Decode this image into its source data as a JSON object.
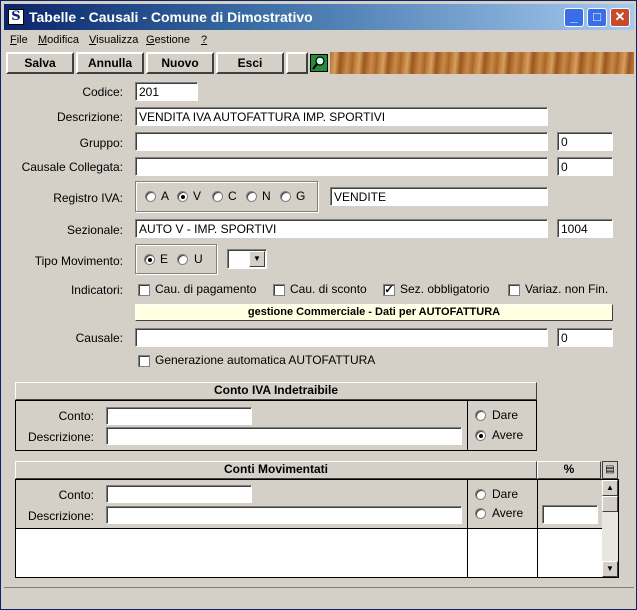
{
  "window": {
    "title": "Tabelle - Causali - Comune di Dimostrativo"
  },
  "menu": [
    "File",
    "Modifica",
    "Visualizza",
    "Gestione",
    "?"
  ],
  "toolbar": {
    "salva": "Salva",
    "annulla": "Annulla",
    "nuovo": "Nuovo",
    "esci": "Esci"
  },
  "form": {
    "codice": {
      "label": "Codice:",
      "value": "201"
    },
    "descrizione": {
      "label": "Descrizione:",
      "value": "VENDITA IVA AUTOFATTURA IMP. SPORTIVI"
    },
    "gruppo": {
      "label": "Gruppo:",
      "value": "",
      "code": "0"
    },
    "causale_collegata": {
      "label": "Causale Collegata:",
      "value": "",
      "code": "0"
    },
    "registro_iva": {
      "label": "Registro IVA:",
      "options": [
        "A",
        "V",
        "C",
        "N",
        "G"
      ],
      "selected": "V",
      "value": "VENDITE"
    },
    "sezionale": {
      "label": "Sezionale:",
      "value": "AUTO V - IMP. SPORTIVI",
      "code": "1004"
    },
    "tipo_movimento": {
      "label": "Tipo Movimento:",
      "options": [
        "E",
        "U"
      ],
      "selected": "E",
      "combo_value": ""
    },
    "indicatori": {
      "label": "Indicatori:",
      "items": [
        {
          "label": "Cau. di pagamento",
          "checked": false
        },
        {
          "label": "Cau. di sconto",
          "checked": false
        },
        {
          "label": "Sez. obbligatorio",
          "checked": true
        },
        {
          "label": "Variaz. non Fin.",
          "checked": false
        }
      ]
    },
    "gestione_bar": "gestione Commerciale - Dati per AUTOFATTURA",
    "causale": {
      "label": "Causale:",
      "value": "",
      "code": "0"
    },
    "generazione": {
      "label": "Generazione automatica AUTOFATTURA",
      "checked": false
    }
  },
  "conto_iva": {
    "header": "Conto IVA Indetraibile",
    "conto_label": "Conto:",
    "descrizione_label": "Descrizione:",
    "conto_value": "",
    "descrizione_value": "",
    "dare": "Dare",
    "avere": "Avere",
    "selected": "Avere"
  },
  "conti_movimentati": {
    "header": "Conti Movimentati",
    "percent_header": "%",
    "conto_label": "Conto:",
    "descrizione_label": "Descrizione:",
    "conto_value": "",
    "descrizione_value": "",
    "dare": "Dare",
    "avere": "Avere",
    "selected": "",
    "percent_value": ""
  }
}
